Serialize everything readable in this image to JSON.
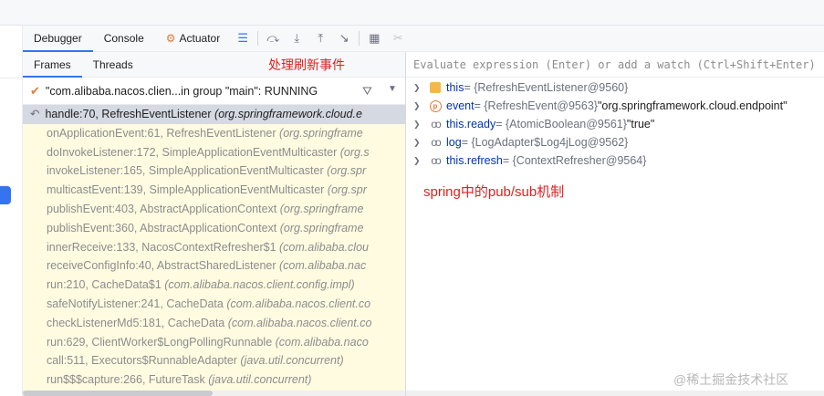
{
  "toolbar": {
    "tabs": [
      {
        "label": "Debugger"
      },
      {
        "label": "Console"
      },
      {
        "label": "Actuator"
      }
    ]
  },
  "frames_panel": {
    "tabs": [
      {
        "label": "Frames"
      },
      {
        "label": "Threads"
      }
    ],
    "annotation": "处理刷新事件",
    "thread_selector": "\"com.alibaba.nacos.clien...in group \"main\": RUNNING",
    "frames": [
      {
        "method": "handle:70, RefreshEventListener ",
        "pkg": "(org.springframework.cloud.e"
      },
      {
        "method": "onApplicationEvent:61, RefreshEventListener ",
        "pkg": "(org.springframe"
      },
      {
        "method": "doInvokeListener:172, SimpleApplicationEventMulticaster ",
        "pkg": "(org.s"
      },
      {
        "method": "invokeListener:165, SimpleApplicationEventMulticaster ",
        "pkg": "(org.spr"
      },
      {
        "method": "multicastEvent:139, SimpleApplicationEventMulticaster ",
        "pkg": "(org.spr"
      },
      {
        "method": "publishEvent:403, AbstractApplicationContext ",
        "pkg": "(org.springframe"
      },
      {
        "method": "publishEvent:360, AbstractApplicationContext ",
        "pkg": "(org.springframe"
      },
      {
        "method": "innerReceive:133, NacosContextRefresher$1 ",
        "pkg": "(com.alibaba.clou"
      },
      {
        "method": "receiveConfigInfo:40, AbstractSharedListener ",
        "pkg": "(com.alibaba.nac"
      },
      {
        "method": "run:210, CacheData$1 ",
        "pkg": "(com.alibaba.nacos.client.config.impl)"
      },
      {
        "method": "safeNotifyListener:241, CacheData ",
        "pkg": "(com.alibaba.nacos.client.co"
      },
      {
        "method": "checkListenerMd5:181, CacheData ",
        "pkg": "(com.alibaba.nacos.client.co"
      },
      {
        "method": "run:629, ClientWorker$LongPollingRunnable ",
        "pkg": "(com.alibaba.naco"
      },
      {
        "method": "call:511, Executors$RunnableAdapter ",
        "pkg": "(java.util.concurrent)"
      },
      {
        "method": "run$$$capture:266, FutureTask ",
        "pkg": "(java.util.concurrent)"
      }
    ]
  },
  "variables_panel": {
    "eval_placeholder": "Evaluate expression (Enter) or add a watch (Ctrl+Shift+Enter)",
    "variables": [
      {
        "name": "this",
        "value": " = {RefreshEventListener@9560}",
        "extra": ""
      },
      {
        "name": "event",
        "value": " = {RefreshEvent@9563} ",
        "extra": "\"org.springframework.cloud.endpoint\""
      },
      {
        "name": "this.ready",
        "value": " = {AtomicBoolean@9561} ",
        "extra": "\"true\""
      },
      {
        "name": "log",
        "value": " = {LogAdapter$Log4jLog@9562}",
        "extra": ""
      },
      {
        "name": "this.refresh",
        "value": " = {ContextRefresher@9564}",
        "extra": ""
      }
    ],
    "annotation": "spring中的pub/sub机制"
  },
  "watermark": "@稀土掘金技术社区",
  "colors": {
    "accent": "#3574f0",
    "annotation": "#e02020",
    "frames_bg": "#fffbe1",
    "selected_frame": "#d5d9e2"
  }
}
